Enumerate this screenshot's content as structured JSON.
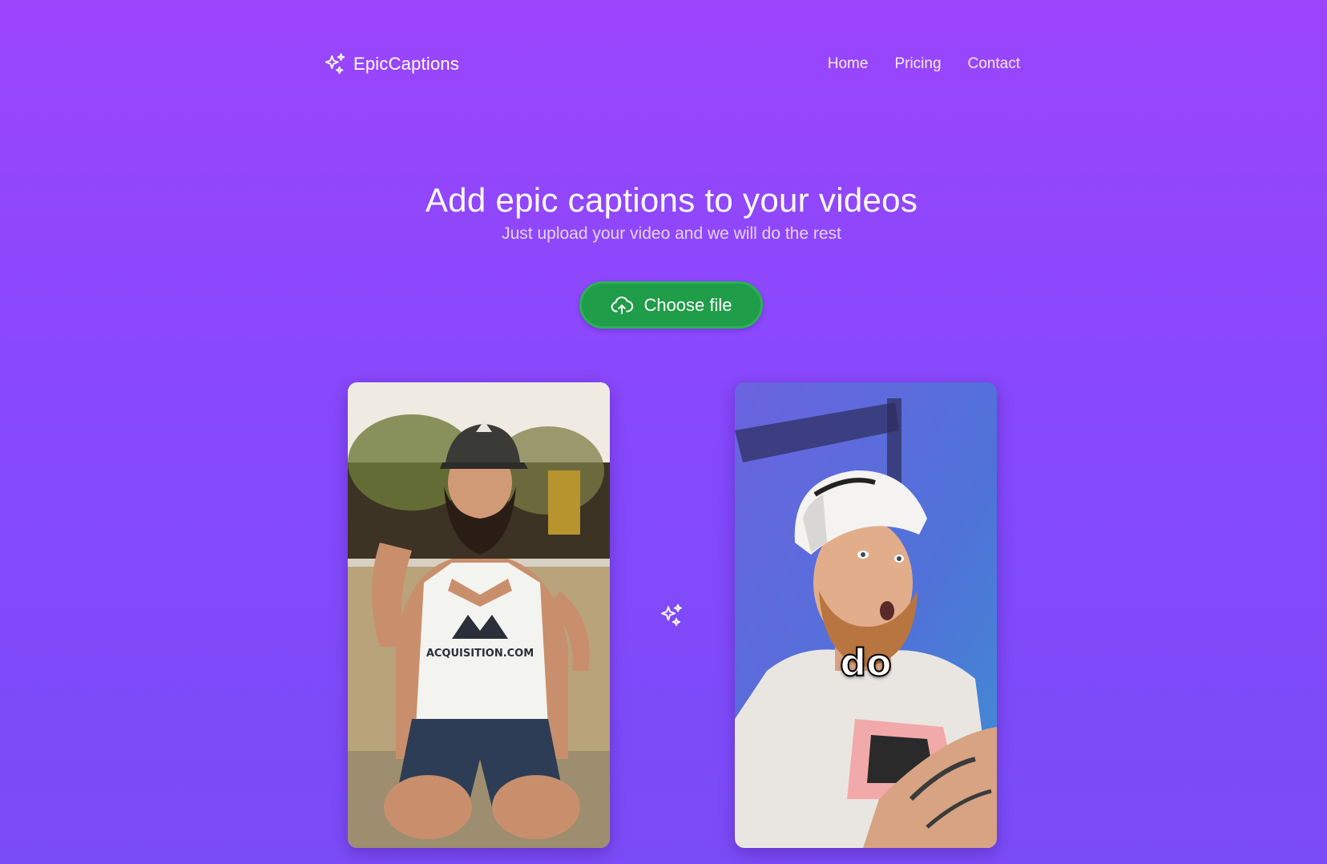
{
  "header": {
    "logo_text": "EpicCaptions",
    "logo_icon": "sparkles-icon",
    "nav": [
      {
        "label": "Home"
      },
      {
        "label": "Pricing"
      },
      {
        "label": "Contact"
      }
    ]
  },
  "hero": {
    "title": "Add epic captions to your videos",
    "subtitle": "Just upload your video and we will do the rest"
  },
  "upload": {
    "label": "Choose file",
    "icon": "cloud-upload-icon"
  },
  "examples": {
    "before": {
      "tank_print": "ACQUISITION.COM"
    },
    "after": {
      "caption_word": "do"
    },
    "transition_icon": "sparkles-icon"
  },
  "colors": {
    "background_top": "#9b45fd",
    "background_bottom": "#7a4cf7",
    "button": "#1f9d48"
  }
}
